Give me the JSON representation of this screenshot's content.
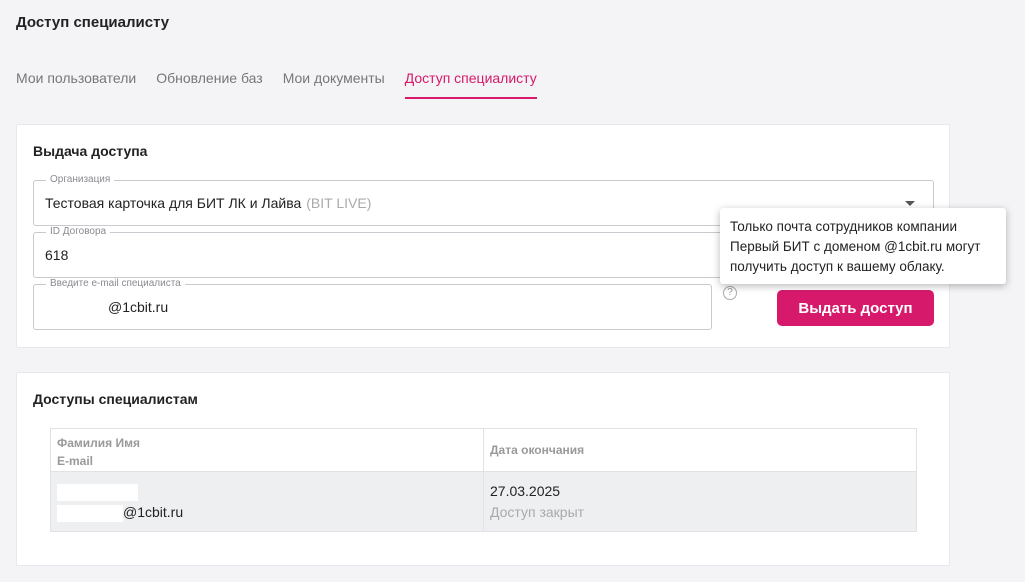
{
  "page": {
    "title": "Доступ специалисту"
  },
  "tabs": [
    {
      "label": "Мои пользователи"
    },
    {
      "label": "Обновление баз"
    },
    {
      "label": "Мои документы"
    },
    {
      "label": "Доступ специалисту"
    }
  ],
  "issue_access": {
    "title": "Выдача доступа",
    "organization": {
      "label": "Организация",
      "value": "Тестовая карточка для БИТ ЛК и Лайва",
      "hint": "(BIT LIVE)"
    },
    "contract": {
      "label": "ID Договора",
      "value": "618"
    },
    "email": {
      "label": "Введите e-mail специалиста",
      "value": "@1cbit.ru"
    },
    "help_icon": "?",
    "submit_label": "Выдать доступ",
    "tooltip": "Только почта сотрудников компании Первый БИТ с доменом @1cbit.ru могут получить доступ к вашему облаку."
  },
  "accesses": {
    "title": "Доступы специалистам",
    "columns": {
      "name": "Фамилия Имя",
      "email": "E-mail",
      "end_date": "Дата окончания"
    },
    "rows": [
      {
        "name": "",
        "email": "@1cbit.ru",
        "end_date": "27.03.2025",
        "status": "Доступ закрыт"
      }
    ]
  },
  "colors": {
    "accent": "#d6196b",
    "background": "#f4f4f6"
  }
}
